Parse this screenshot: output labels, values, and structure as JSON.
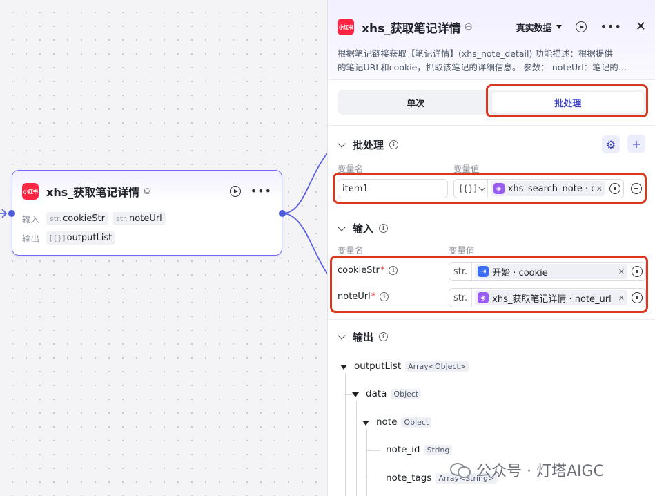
{
  "node": {
    "logo_text": "小红书",
    "title": "xhs_获取笔记详情",
    "input_label": "输入",
    "output_label": "输出",
    "inputs": [
      {
        "type": "str.",
        "name": "cookieStr"
      },
      {
        "type": "str.",
        "name": "noteUrl"
      }
    ],
    "outputs": [
      {
        "type": "[{}]",
        "name": "outputList"
      }
    ]
  },
  "panel": {
    "logo_text": "小红书",
    "title": "xhs_获取笔记详情",
    "mode": "真实数据",
    "description_line1": "根据笔记链接获取【笔记详情】(xhs_note_detail) 功能描述：根据提供",
    "description_line2": "的笔记URL和cookie，抓取该笔记的详细信息。 参数： noteUrl：笔记的…",
    "tabs": [
      "单次",
      "批处理"
    ],
    "active_tab": "批处理",
    "batch": {
      "title": "批处理",
      "col_name": "变量名",
      "col_value": "变量值",
      "item_name": "item1",
      "item_type": "[{}]",
      "item_ref": "xhs_search_note · d··"
    },
    "inputs": {
      "title": "输入",
      "col_name": "变量名",
      "col_value": "变量值",
      "fields": [
        {
          "name": "cookieStr",
          "required_mark": "*",
          "type": "str.",
          "ref": "开始 · cookie"
        },
        {
          "name": "noteUrl",
          "required_mark": "*",
          "type": "str.",
          "ref": "xhs_获取笔记详情 · note_url"
        }
      ]
    },
    "outputs": {
      "title": "输出",
      "tree": [
        {
          "name": "outputList",
          "type": "Array<Object>"
        },
        {
          "name": "data",
          "type": "Object"
        },
        {
          "name": "note",
          "type": "Object"
        },
        {
          "name": "note_id",
          "type": "String"
        },
        {
          "name": "note_tags",
          "type": "Array<String>"
        }
      ]
    }
  },
  "watermark": "公众号 · 灯塔AIGC",
  "colors": {
    "accent": "#3a3fbf",
    "node_border": "#6c6cf5",
    "highlight": "#d9381e",
    "brand_red": "#ff2442"
  }
}
